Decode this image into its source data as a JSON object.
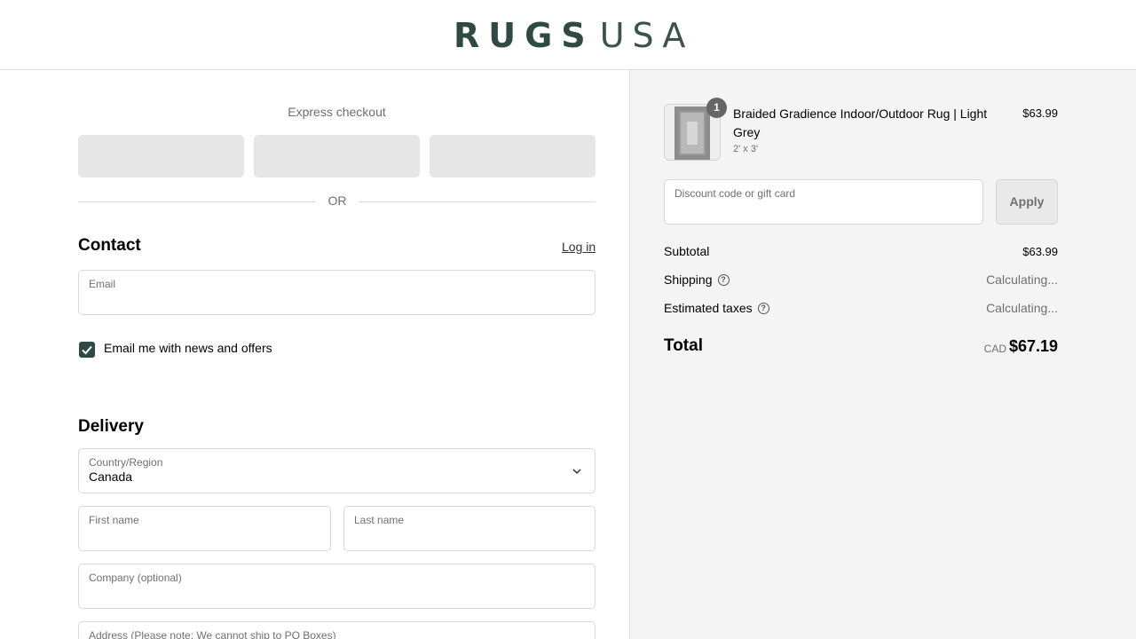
{
  "header": {
    "logo_primary": "RUGS",
    "logo_secondary": "USA"
  },
  "express": {
    "title": "Express checkout",
    "or_text": "OR"
  },
  "contact": {
    "title": "Contact",
    "login_label": "Log in",
    "email_label": "Email",
    "email_value": "",
    "newsletter_label": "Email me with news and offers",
    "newsletter_checked": true
  },
  "delivery": {
    "title": "Delivery",
    "country_label": "Country/Region",
    "country_value": "Canada",
    "first_name_label": "First name",
    "last_name_label": "Last name",
    "company_label": "Company (optional)",
    "address_label": "Address (Please note: We cannot ship to PO Boxes)"
  },
  "cart": {
    "item": {
      "quantity": "1",
      "name": "Braided Gradience Indoor/Outdoor Rug | Light Grey",
      "variant": "2' x 3'",
      "price": "$63.99"
    },
    "discount_label": "Discount code or gift card",
    "apply_label": "Apply",
    "subtotal_label": "Subtotal",
    "subtotal_value": "$63.99",
    "shipping_label": "Shipping",
    "shipping_value": "Calculating...",
    "taxes_label": "Estimated taxes",
    "taxes_value": "Calculating...",
    "total_label": "Total",
    "total_currency": "CAD",
    "total_value": "$67.19"
  },
  "colors": {
    "brand": "#2f4a42",
    "summary_bg": "#f4f4f4",
    "express_btn": "#e6e6e6"
  }
}
